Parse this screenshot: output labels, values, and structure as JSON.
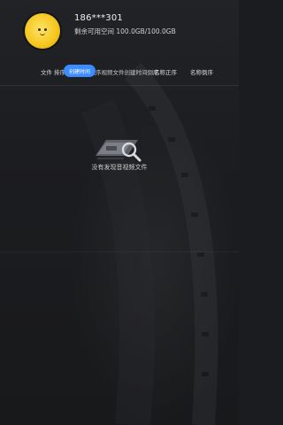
{
  "user": {
    "name": "186***301",
    "storage_text": "剩余可用空间 100.0GB/100.0GB"
  },
  "sort_bar": {
    "file_label": "文件",
    "sort_label": "排序",
    "active_label": "创建时间",
    "mixed_text": "间正序视频文件创建时间倒序",
    "name_asc": "名称正序",
    "name_desc": "名称倒序",
    "accent_color": "#3b8cff"
  },
  "empty_state": {
    "message": "没有发现音视频文件",
    "icon": "search-video-icon"
  }
}
